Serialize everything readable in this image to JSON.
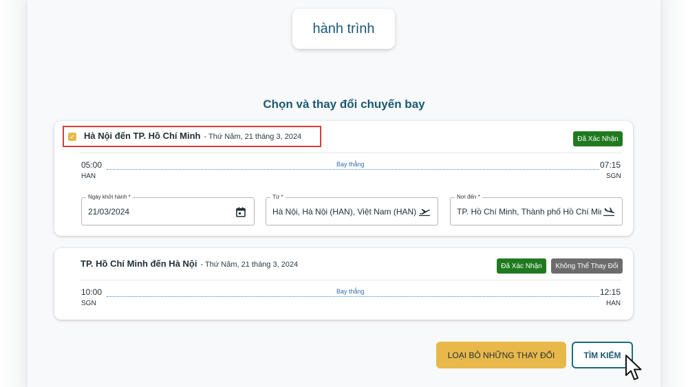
{
  "header": {
    "journey_chip": "hành trình"
  },
  "section_title": "Chọn và thay đổi chuyến bay",
  "flights": [
    {
      "route": "Hà Nội đến TP. Hồ Chí Minh",
      "date": "- Thứ Năm, 21 tháng 3, 2024",
      "badges": [
        "Đã Xác Nhận"
      ],
      "dep_time": "05:00",
      "dep_code": "HAN",
      "arr_time": "07:15",
      "arr_code": "SGN",
      "stop_label": "Bay thẳng",
      "selected": true
    },
    {
      "route": "TP. Hồ Chí Minh đến Hà Nội",
      "date": "- Thứ Năm, 21 tháng 3, 2024",
      "badges": [
        "Đã Xác Nhận",
        "Không Thể Thay Đổi"
      ],
      "dep_time": "10:00",
      "dep_code": "SGN",
      "arr_time": "12:15",
      "arr_code": "HAN",
      "stop_label": "Bay thẳng"
    }
  ],
  "form": {
    "departure_date": {
      "label": "Ngày khởi hành *",
      "value": "21/03/2024",
      "icon": "calendar-icon"
    },
    "from": {
      "label": "Từ *",
      "value": "Hà Nội, Hà Nội (HAN), Việt Nam (HAN)",
      "icon": "plane-takeoff-icon"
    },
    "to": {
      "label": "Nơi đến *",
      "value": "TP. Hồ Chí Minh, Thành phố Hồ Chí Minh (SGN)",
      "icon": "plane-landing-icon"
    }
  },
  "actions": {
    "discard_label": "LOẠI BỎ NHỮNG THAY ĐỔI",
    "search_label": "TÌM KIẾM"
  },
  "colors": {
    "brand_teal": "#1a5872",
    "confirmed_green": "#1f7a1f",
    "locked_grey": "#6c6c6c",
    "accent_yellow": "#e8b94a",
    "highlight_red": "#d93a3a"
  }
}
